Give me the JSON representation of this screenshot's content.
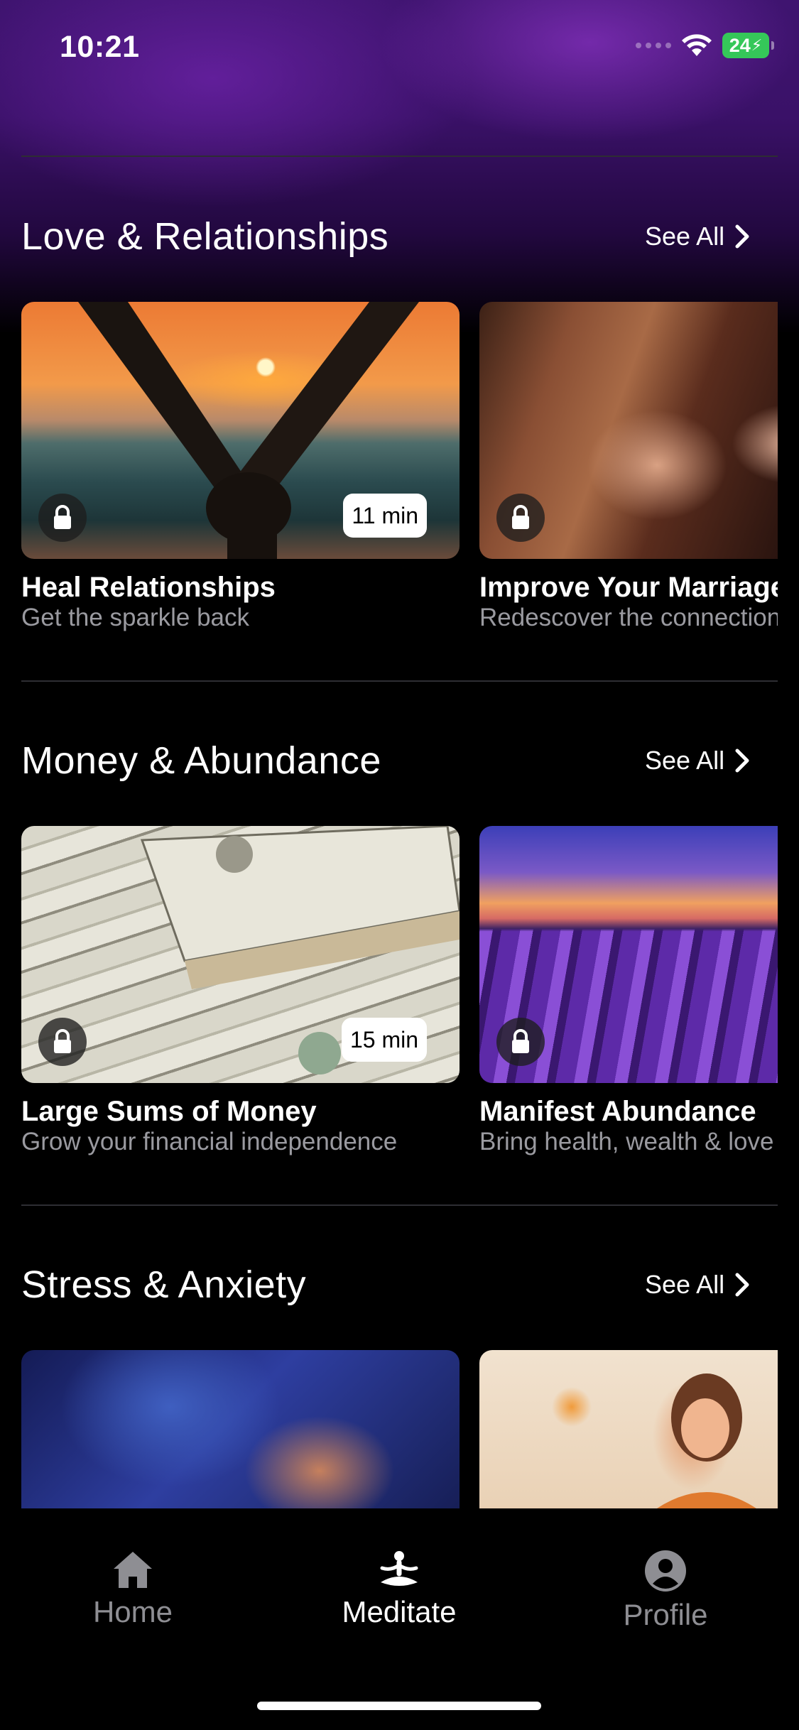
{
  "status_bar": {
    "time": "10:21",
    "battery": "24"
  },
  "sections": [
    {
      "title": "Love & Relationships",
      "see_all": "See All",
      "cards": [
        {
          "title": "Heal Relationships",
          "subtitle": "Get the sparkle back",
          "duration": "11 min",
          "locked": true
        },
        {
          "title": "Improve Your Marriage",
          "subtitle": "Redescover the connection",
          "locked": true
        }
      ]
    },
    {
      "title": "Money & Abundance",
      "see_all": "See All",
      "cards": [
        {
          "title": "Large Sums of Money",
          "subtitle": "Grow your financial independence",
          "duration": "15 min",
          "locked": true
        },
        {
          "title": "Manifest Abundance",
          "subtitle": "Bring health, wealth & love",
          "locked": true
        }
      ]
    },
    {
      "title": "Stress & Anxiety",
      "see_all": "See All",
      "cards": [
        {
          "title": "",
          "subtitle": ""
        },
        {
          "title": "",
          "subtitle": ""
        }
      ]
    }
  ],
  "tabbar": {
    "tabs": [
      {
        "label": "Home",
        "icon": "home-icon",
        "active": false
      },
      {
        "label": "Meditate",
        "icon": "meditate-icon",
        "active": true
      },
      {
        "label": "Profile",
        "icon": "profile-icon",
        "active": false
      }
    ]
  },
  "colors": {
    "accent_purple": "#3a1168",
    "inactive_tab": "#8e8e93",
    "active_tab": "#ffffff",
    "battery": "#35c759"
  }
}
